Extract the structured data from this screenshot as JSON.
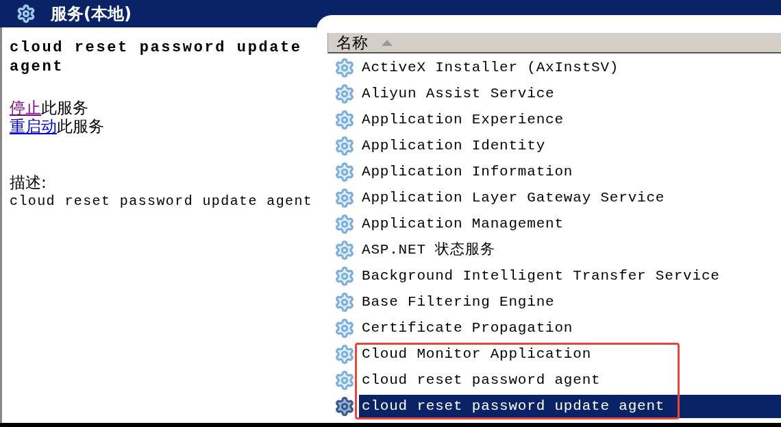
{
  "title_bar": {
    "title": "服务(本地)"
  },
  "details": {
    "service_name": "cloud reset password update agent",
    "actions": [
      {
        "link": "停止",
        "text": "此服务",
        "visited": true
      },
      {
        "link": "重启动",
        "text": "此服务",
        "visited": false
      }
    ],
    "description_label": "描述:",
    "description": "cloud reset password update agent"
  },
  "service_list": {
    "columns": [
      {
        "label": "名称",
        "sorted_ascending": true
      }
    ],
    "rows": [
      {
        "name": "ActiveX Installer (AxInstSV)",
        "selected": false,
        "boxed": false
      },
      {
        "name": "Aliyun Assist Service",
        "selected": false,
        "boxed": false
      },
      {
        "name": "Application Experience",
        "selected": false,
        "boxed": false
      },
      {
        "name": "Application Identity",
        "selected": false,
        "boxed": false
      },
      {
        "name": "Application Information",
        "selected": false,
        "boxed": false
      },
      {
        "name": "Application Layer Gateway Service",
        "selected": false,
        "boxed": false
      },
      {
        "name": "Application Management",
        "selected": false,
        "boxed": false
      },
      {
        "name": "ASP.NET 状态服务",
        "selected": false,
        "boxed": false
      },
      {
        "name": "Background Intelligent Transfer Service",
        "selected": false,
        "boxed": false
      },
      {
        "name": "Base Filtering Engine",
        "selected": false,
        "boxed": false
      },
      {
        "name": "Certificate Propagation",
        "selected": false,
        "boxed": false
      },
      {
        "name": "Cloud Monitor Application",
        "selected": false,
        "boxed": true
      },
      {
        "name": "cloud reset password agent",
        "selected": false,
        "boxed": true
      },
      {
        "name": "cloud reset password update agent",
        "selected": true,
        "boxed": true
      }
    ]
  }
}
